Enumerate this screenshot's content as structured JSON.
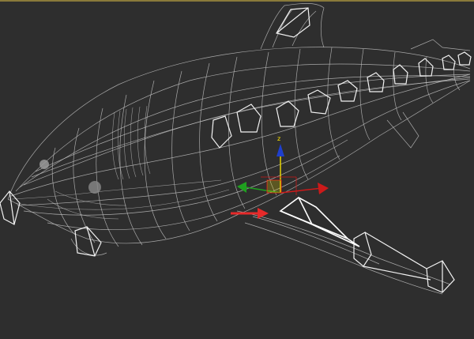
{
  "viewport": {
    "gizmo_axis_label": "z",
    "colors": {
      "background": "#2e2e2e",
      "wireframe": "#bdbdbd",
      "bones": "#f2f2f2",
      "axis_x": "#cc1a1a",
      "axis_y": "#1fa01f",
      "axis_z": "#1f3fcc",
      "axis_z_line": "#e6d400",
      "indicator_arrow": "#e62a2a",
      "top_border": "#8a7a3a"
    },
    "icons": [
      "transform-gizmo-icon",
      "indicator-arrow-icon"
    ]
  }
}
